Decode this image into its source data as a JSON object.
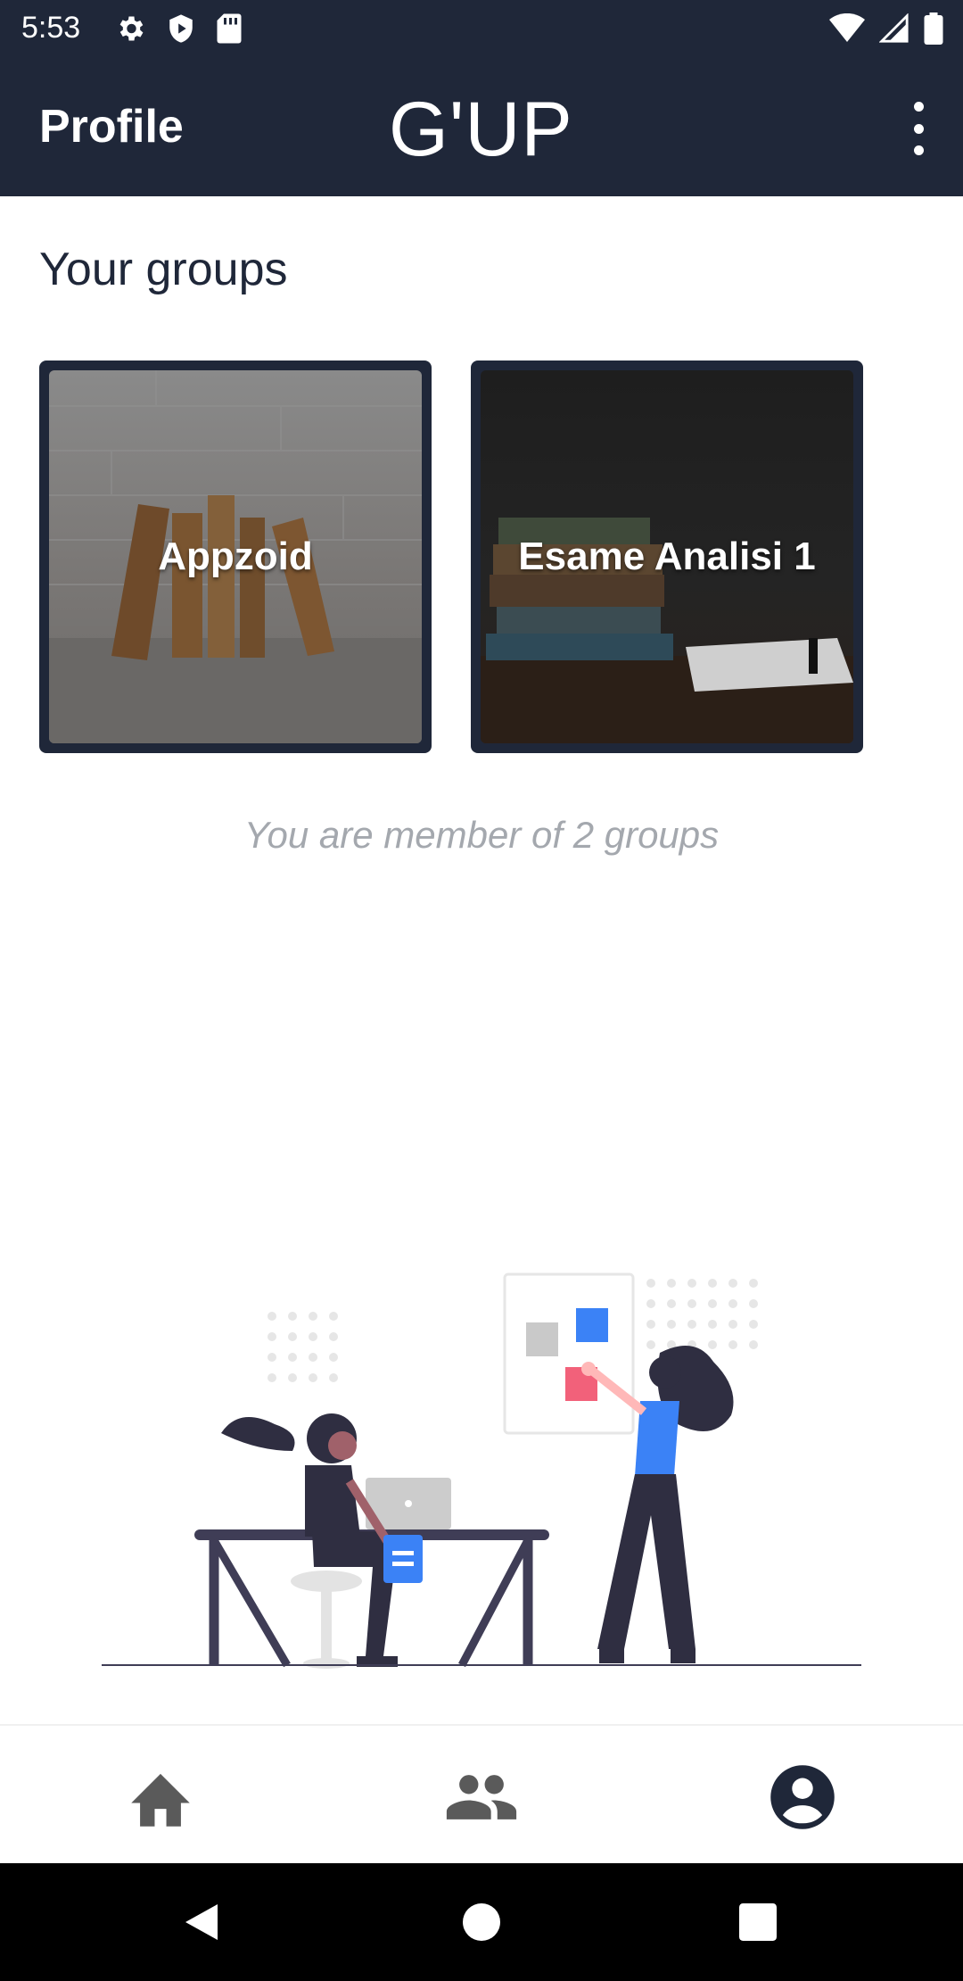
{
  "status_bar": {
    "time": "5:53",
    "left_icons": [
      "gear-icon",
      "shield-icon",
      "sd-card-icon"
    ],
    "right_icons": [
      "wifi-icon",
      "signal-icon",
      "battery-icon"
    ]
  },
  "app_bar": {
    "title": "Profile",
    "logo": "G'UP",
    "menu_icon": "more-vert-icon"
  },
  "groups": {
    "heading": "Your groups",
    "items": [
      {
        "name": "Appzoid"
      },
      {
        "name": "Esame Analisi 1"
      }
    ],
    "summary": "You are member of 2 groups"
  },
  "colors": {
    "primary": "#1f2739",
    "accent_blue": "#3b82f6",
    "accent_pink": "#f2617a",
    "muted_text": "#a4a8ae",
    "nav_icon": "#5a5a5a"
  },
  "bottom_nav": {
    "items": [
      {
        "icon": "home-icon",
        "active": false
      },
      {
        "icon": "groups-icon",
        "active": false
      },
      {
        "icon": "account-circle-icon",
        "active": true
      }
    ]
  },
  "system_nav": [
    "back-icon",
    "home-circle-icon",
    "recents-icon"
  ]
}
